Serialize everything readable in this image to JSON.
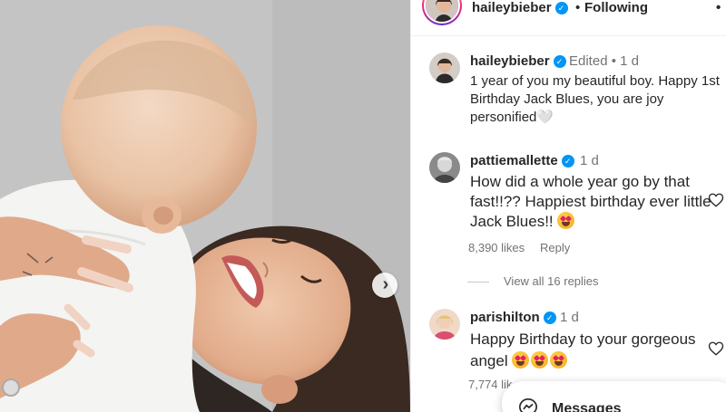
{
  "post": {
    "author": "haileybieber",
    "follow_status": "Following",
    "separator": "•",
    "more": "•"
  },
  "caption": {
    "user": "haileybieber",
    "edited": "Edited • 1 d",
    "text": "1 year of you my beautiful boy. Happy 1st Birthday Jack Blues, you are joy personified🤍"
  },
  "comments": [
    {
      "user": "pattiemallette",
      "time": "1 d",
      "text": "How did a whole year go by that fast!!?? Happiest birthday ever little Jack Blues!!",
      "likes": "8,390 likes",
      "reply_label": "Reply",
      "view_replies": "View all 16 replies",
      "emoji_count": 1
    },
    {
      "user": "parishilton",
      "time": "1 d",
      "text": "Happy Birthday to your gorgeous angel",
      "likes": "7,774 lik",
      "emoji_count": 3
    }
  ],
  "messages": {
    "label": "Messages"
  },
  "colors": {
    "verified": "#0095f6",
    "muted": "#737373",
    "text": "#262626"
  },
  "icons": [
    "verified-badge-icon",
    "heart-icon",
    "chevron-right-icon",
    "messages-icon",
    "star-struck-emoji"
  ]
}
